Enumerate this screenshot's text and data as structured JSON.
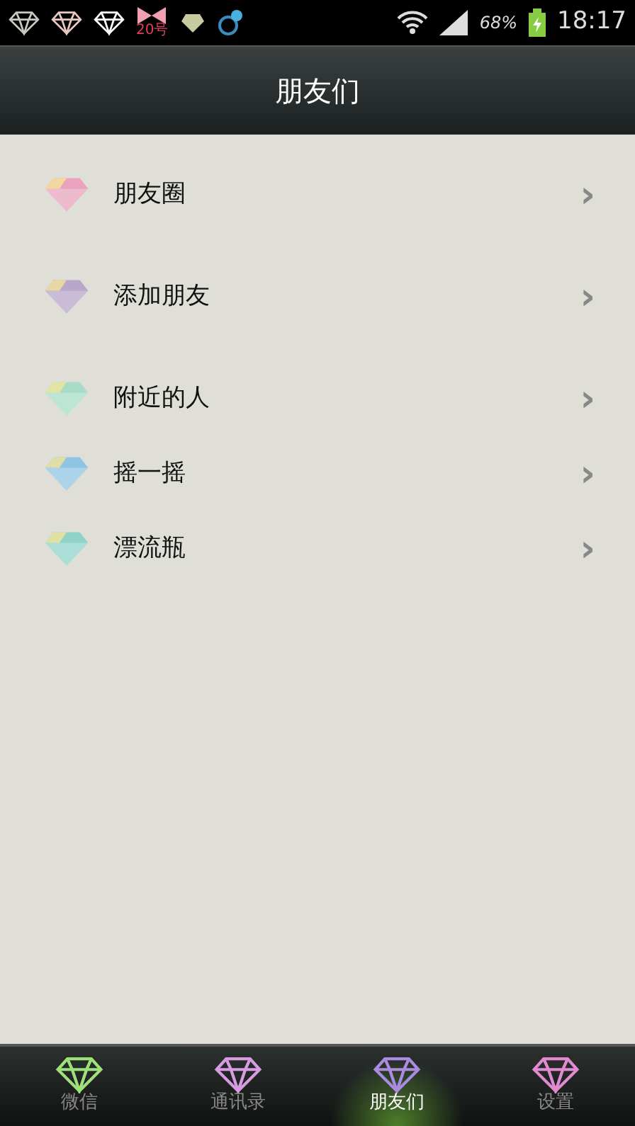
{
  "status_bar": {
    "notification_badge": "20号",
    "battery": "68%",
    "time": "18:17"
  },
  "header": {
    "title": "朋友们"
  },
  "sections": [
    {
      "items": [
        {
          "label": "朋友圈",
          "color": "#e9a3bd",
          "chevron": "›"
        }
      ]
    },
    {
      "items": [
        {
          "label": "添加朋友",
          "color": "#b9a6c9",
          "chevron": "›"
        }
      ]
    },
    {
      "items": [
        {
          "label": "附近的人",
          "color": "#a7dcc9",
          "chevron": "›"
        },
        {
          "label": "摇一摇",
          "color": "#8fc4e3",
          "chevron": "›"
        },
        {
          "label": "漂流瓶",
          "color": "#8fd3c8",
          "chevron": "›"
        }
      ]
    }
  ],
  "tabs": [
    {
      "label": "微信",
      "color": "#9ee07a",
      "selected": false
    },
    {
      "label": "通讯录",
      "color": "#d79be0",
      "selected": false
    },
    {
      "label": "朋友们",
      "color": "#a98be0",
      "selected": true
    },
    {
      "label": "设置",
      "color": "#e08bd0",
      "selected": false
    }
  ]
}
